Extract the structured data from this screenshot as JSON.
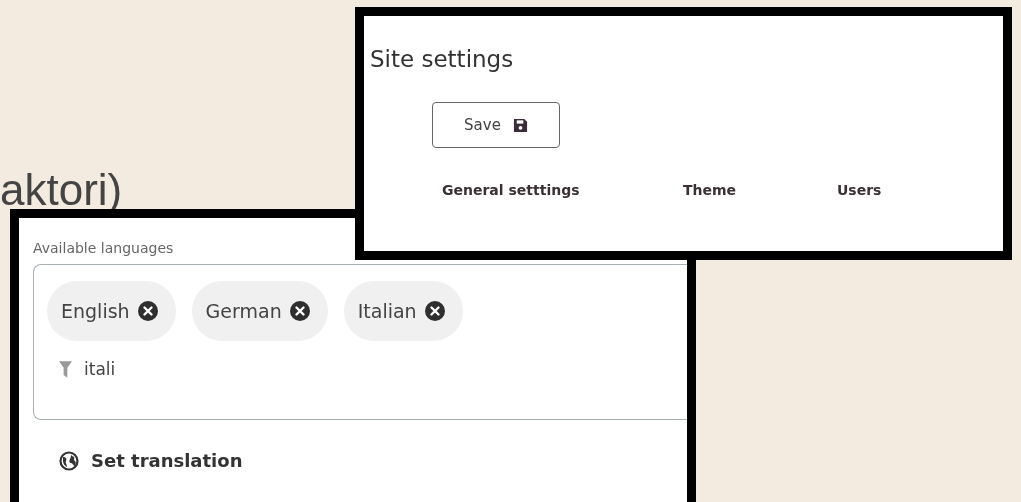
{
  "caption": "aktori)",
  "site_settings": {
    "title": "Site settings",
    "save_button": "Save",
    "tabs": [
      "General setttings",
      "Theme",
      "Users"
    ]
  },
  "languages": {
    "label": "Available languages",
    "chips": [
      {
        "label": "English"
      },
      {
        "label": "German"
      },
      {
        "label": "Italian"
      }
    ],
    "filter": {
      "value": "itali"
    },
    "set_translation": "Set translation"
  }
}
